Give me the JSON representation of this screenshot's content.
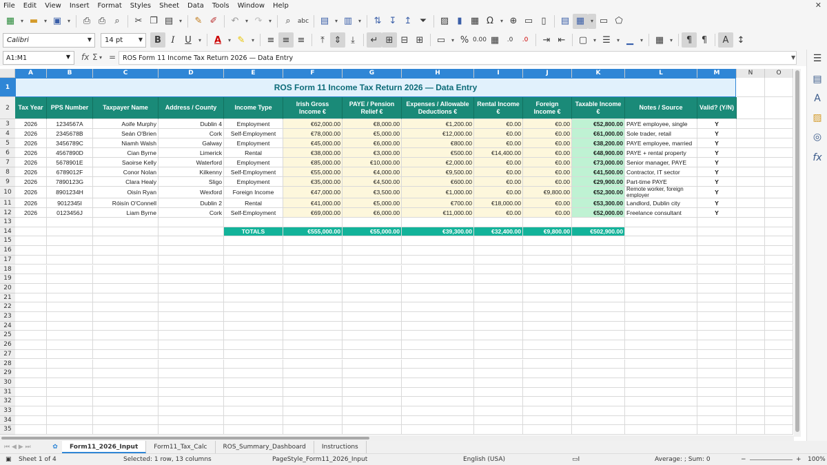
{
  "menu": [
    "File",
    "Edit",
    "View",
    "Insert",
    "Format",
    "Styles",
    "Sheet",
    "Data",
    "Tools",
    "Window",
    "Help"
  ],
  "toolbar": {
    "font_name": "Calibri",
    "font_size": "14 pt",
    "bold": "B",
    "italic": "I",
    "underline": "U",
    "percent": "%",
    "number_format": "0.00"
  },
  "formula_bar": {
    "name_box": "A1:M1",
    "formula": "ROS Form 11 Income Tax Return 2026 — Data Entry"
  },
  "columns": [
    {
      "id": "A",
      "w": 46
    },
    {
      "id": "B",
      "w": 67
    },
    {
      "id": "C",
      "w": 95
    },
    {
      "id": "D",
      "w": 95
    },
    {
      "id": "E",
      "w": 86
    },
    {
      "id": "F",
      "w": 86
    },
    {
      "id": "G",
      "w": 86
    },
    {
      "id": "H",
      "w": 105
    },
    {
      "id": "I",
      "w": 71
    },
    {
      "id": "J",
      "w": 71
    },
    {
      "id": "K",
      "w": 77
    },
    {
      "id": "L",
      "w": 105
    },
    {
      "id": "M",
      "w": 57
    },
    {
      "id": "N",
      "w": 41
    },
    {
      "id": "O",
      "w": 41
    }
  ],
  "sheet": {
    "title": "ROS Form 11 Income Tax Return 2026 — Data Entry",
    "headers": [
      "Tax Year",
      "PPS Number",
      "Taxpayer Name",
      "Address / County",
      "Income Type",
      "Irish Gross Income €",
      "PAYE / Pension Relief €",
      "Expenses / Allowable Deductions €",
      "Rental Income €",
      "Foreign Income €",
      "Taxable Income €",
      "Notes / Source",
      "Valid? (Y/N)"
    ],
    "rows": [
      [
        "2026",
        "1234567A",
        "Aoife Murphy",
        "Dublin 4",
        "Employment",
        "€62,000.00",
        "€8,000.00",
        "€1,200.00",
        "€0.00",
        "€0.00",
        "€52,800.00",
        "PAYE employee, single",
        "Y"
      ],
      [
        "2026",
        "2345678B",
        "Seán O'Brien",
        "Cork",
        "Self-Employment",
        "€78,000.00",
        "€5,000.00",
        "€12,000.00",
        "€0.00",
        "€0.00",
        "€61,000.00",
        "Sole trader, retail",
        "Y"
      ],
      [
        "2026",
        "3456789C",
        "Niamh Walsh",
        "Galway",
        "Employment",
        "€45,000.00",
        "€6,000.00",
        "€800.00",
        "€0.00",
        "€0.00",
        "€38,200.00",
        "PAYE employee, married",
        "Y"
      ],
      [
        "2026",
        "4567890D",
        "Cian Byrne",
        "Limerick",
        "Rental",
        "€38,000.00",
        "€3,000.00",
        "€500.00",
        "€14,400.00",
        "€0.00",
        "€48,900.00",
        "PAYE + rental property",
        "Y"
      ],
      [
        "2026",
        "5678901E",
        "Saoirse Kelly",
        "Waterford",
        "Employment",
        "€85,000.00",
        "€10,000.00",
        "€2,000.00",
        "€0.00",
        "€0.00",
        "€73,000.00",
        "Senior manager, PAYE",
        "Y"
      ],
      [
        "2026",
        "6789012F",
        "Conor Nolan",
        "Kilkenny",
        "Self-Employment",
        "€55,000.00",
        "€4,000.00",
        "€9,500.00",
        "€0.00",
        "€0.00",
        "€41,500.00",
        "Contractor, IT sector",
        "Y"
      ],
      [
        "2026",
        "7890123G",
        "Clara Healy",
        "Sligo",
        "Employment",
        "€35,000.00",
        "€4,500.00",
        "€600.00",
        "€0.00",
        "€0.00",
        "€29,900.00",
        "Part-time PAYE",
        "Y"
      ],
      [
        "2026",
        "8901234H",
        "Oisín Ryan",
        "Wexford",
        "Foreign Income",
        "€47,000.00",
        "€3,500.00",
        "€1,000.00",
        "€0.00",
        "€9,800.00",
        "€52,300.00",
        "Remote worker, foreign employer",
        "Y"
      ],
      [
        "2026",
        "9012345I",
        "Róisín O'Connell",
        "Dublin 2",
        "Rental",
        "€41,000.00",
        "€5,000.00",
        "€700.00",
        "€18,000.00",
        "€0.00",
        "€53,300.00",
        "Landlord, Dublin city",
        "Y"
      ],
      [
        "2026",
        "0123456J",
        "Liam Byrne",
        "Cork",
        "Self-Employment",
        "€69,000.00",
        "€6,000.00",
        "€11,000.00",
        "€0.00",
        "€0.00",
        "€52,000.00",
        "Freelance consultant",
        "Y"
      ]
    ],
    "totals": {
      "label": "TOTALS",
      "values": [
        "€555,000.00",
        "€55,000.00",
        "€39,300.00",
        "€32,400.00",
        "€9,800.00",
        "€502,900.00"
      ]
    },
    "row_numbers": [
      "1",
      "2",
      "3",
      "4",
      "5",
      "6",
      "7",
      "8",
      "9",
      "10",
      "11",
      "12",
      "13",
      "14",
      "15",
      "16",
      "17",
      "18",
      "19",
      "20",
      "21",
      "22",
      "23",
      "24",
      "25",
      "26",
      "27",
      "28",
      "29",
      "30",
      "31",
      "32",
      "33",
      "34",
      "35"
    ]
  },
  "tabs": [
    "Form11_2026_Input",
    "Form11_Tax_Calc",
    "ROS_Summary_Dashboard",
    "Instructions"
  ],
  "active_tab": "Form11_2026_Input",
  "status": {
    "sheet": "Sheet 1 of 4",
    "selection": "Selected: 1 row, 13 columns",
    "page_style": "PageStyle_Form11_2026_Input",
    "language": "English (USA)",
    "sum": "Average: ; Sum: 0",
    "zoom": "100%"
  },
  "colors": {
    "header_teal": "#1a8a78",
    "totals_teal": "#13b39a",
    "taxable_green": "#bff2d3",
    "money_cream": "#fdf7dc",
    "title_bg": "#e1f1fc",
    "selection_blue": "#2f86d6"
  }
}
